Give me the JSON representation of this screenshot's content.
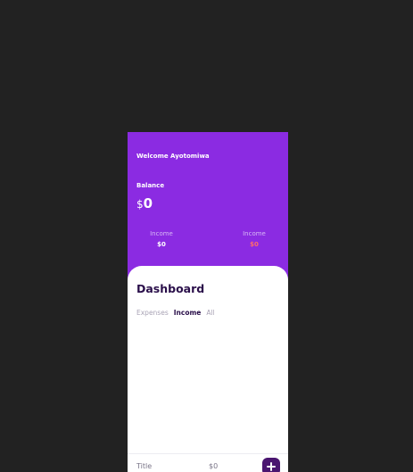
{
  "header": {
    "welcome": "Welcome Ayotomiwa",
    "balance_label": "Balance",
    "balance_currency": "$",
    "balance_amount": "0"
  },
  "stats": [
    {
      "label": "Income",
      "value": "$0",
      "color": "#ffffff"
    },
    {
      "label": "Income",
      "value": "$0",
      "color": "#ff6b6b"
    }
  ],
  "dashboard": {
    "title": "Dashboard",
    "tabs": [
      {
        "label": "Expenses",
        "active": false
      },
      {
        "label": "Income",
        "active": true
      },
      {
        "label": "All",
        "active": false
      }
    ]
  },
  "footer": {
    "title": "Title",
    "amount": "$0",
    "add_icon": "plus-icon"
  },
  "colors": {
    "background": "#222222",
    "accent": "#8b2be2",
    "dark": "#2a0f4a",
    "button": "#4a1570",
    "expense": "#ff6b6b"
  }
}
